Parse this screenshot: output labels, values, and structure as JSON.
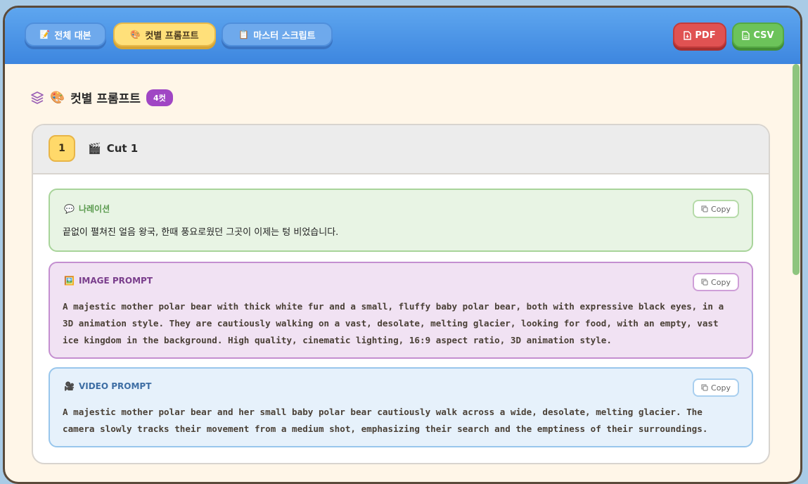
{
  "tabs": [
    {
      "icon": "📝",
      "label": "전체 대본"
    },
    {
      "icon": "🎨",
      "label": "컷별 프롬프트"
    },
    {
      "icon": "📋",
      "label": "마스터 스크립트"
    }
  ],
  "downloads": {
    "pdf_label": "PDF",
    "csv_label": "CSV"
  },
  "section": {
    "emoji": "🎨",
    "title": "컷별 프롬프트",
    "count_badge": "4컷"
  },
  "cut": {
    "number": "1",
    "emoji": "🎬",
    "title": "Cut 1",
    "narration": {
      "emoji": "💬",
      "label": "나레이션",
      "copy_label": "Copy",
      "text": "끝없이 펼쳐진 얼음 왕국, 한때 풍요로웠던 그곳이 이제는 텅 비었습니다."
    },
    "image_prompt": {
      "emoji": "🖼️",
      "label": "IMAGE PROMPT",
      "copy_label": "Copy",
      "text": "A majestic mother polar bear with thick white fur and a small, fluffy baby polar bear, both with expressive black eyes, in a 3D animation style. They are cautiously walking on a vast, desolate, melting glacier, looking for food, with an empty, vast ice kingdom in the background. High quality, cinematic lighting, 16:9 aspect ratio, 3D animation style."
    },
    "video_prompt": {
      "emoji": "🎥",
      "label": "VIDEO PROMPT",
      "copy_label": "Copy",
      "text": "A majestic mother polar bear and her small baby polar bear cautiously walk across a wide, desolate, melting glacier. The camera slowly tracks their movement from a medium shot, emphasizing their search and the emptiness of their surroundings."
    }
  }
}
